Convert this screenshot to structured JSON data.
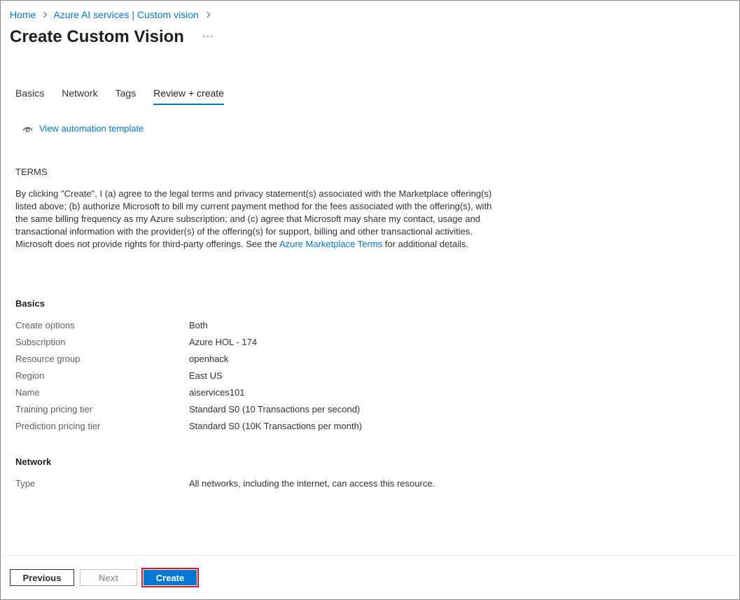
{
  "breadcrumb": {
    "home": "Home",
    "service": "Azure AI services | Custom vision"
  },
  "page": {
    "title": "Create Custom Vision",
    "more": "···"
  },
  "tabs": [
    {
      "label": "Basics"
    },
    {
      "label": "Network"
    },
    {
      "label": "Tags"
    },
    {
      "label": "Review + create"
    }
  ],
  "automation": {
    "label": "View automation template",
    "icon": "eye-icon"
  },
  "terms": {
    "heading": "TERMS",
    "text_before_link": "By clicking \"Create\", I (a) agree to the legal terms and privacy statement(s) associated with the Marketplace offering(s) listed above; (b) authorize Microsoft to bill my current payment method for the fees associated with the offering(s), with the same billing frequency as my Azure subscription; and (c) agree that Microsoft may share my contact, usage and transactional information with the provider(s) of the offering(s) for support, billing and other transactional activities. Microsoft does not provide rights for third-party offerings. See the ",
    "link": "Azure Marketplace Terms",
    "text_after_link": " for additional details."
  },
  "basics": {
    "title": "Basics",
    "rows": [
      {
        "label": "Create options",
        "value": "Both"
      },
      {
        "label": "Subscription",
        "value": "Azure HOL - 174"
      },
      {
        "label": "Resource group",
        "value": "openhack"
      },
      {
        "label": "Region",
        "value": "East US"
      },
      {
        "label": "Name",
        "value": "aiservices101"
      },
      {
        "label": "Training pricing tier",
        "value": "Standard S0 (10 Transactions per second)"
      },
      {
        "label": "Prediction pricing tier",
        "value": "Standard S0 (10K Transactions per month)"
      }
    ]
  },
  "network": {
    "title": "Network",
    "rows": [
      {
        "label": "Type",
        "value": "All networks, including the internet, can access this resource."
      }
    ]
  },
  "footer": {
    "previous": "Previous",
    "next": "Next",
    "create": "Create"
  },
  "colors": {
    "accent": "#0078d4",
    "highlight": "#e81123"
  }
}
